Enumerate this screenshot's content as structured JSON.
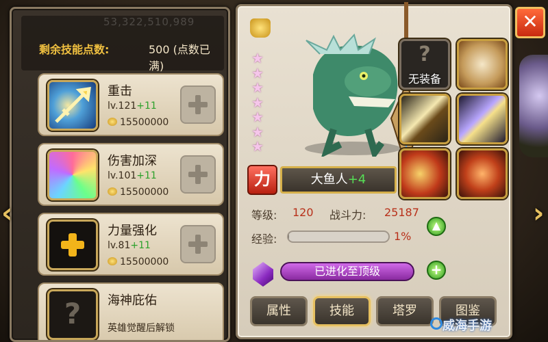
{
  "header": {
    "ghost_text": "53,322,510,989",
    "points_label": "剩余技能点数:",
    "points_value": "500 (点数已满)"
  },
  "skills": [
    {
      "name": "重击",
      "level": "lv.121",
      "level_bonus": "+11",
      "cost": "15500000",
      "icon": "spear-icon"
    },
    {
      "name": "伤害加深",
      "level": "lv.101",
      "level_bonus": "+11",
      "cost": "15500000",
      "icon": "burst-icon"
    },
    {
      "name": "力量强化",
      "level": "lv.81",
      "level_bonus": "+11",
      "cost": "15500000",
      "icon": "cross-icon"
    },
    {
      "name": "海神庇佑",
      "locked_text": "英雄觉醒后解锁",
      "icon": "question-icon"
    }
  ],
  "hero": {
    "star_count": 7,
    "attribute": "力",
    "name": "大鱼人",
    "name_bonus": "+4",
    "level_label": "等级:",
    "level_value": "120",
    "power_label": "战斗力:",
    "power_value": "25187",
    "exp_label": "经验:",
    "exp_pct": "1%",
    "exp_fraction": 0.01,
    "evolve_text": "已进化至顶级"
  },
  "equipment": {
    "empty_label": "无装备",
    "empty_glyph": "?",
    "slots": [
      "empty",
      "armor-icon",
      "sword-icon",
      "dagger-icon",
      "axe-icon",
      "mask-icon"
    ]
  },
  "tabs": [
    {
      "label": "属性",
      "active": false
    },
    {
      "label": "技能",
      "active": true
    },
    {
      "label": "塔罗",
      "active": false
    },
    {
      "label": "图鉴",
      "active": false
    }
  ],
  "glyphs": {
    "close": "✕",
    "star": "★",
    "up": "▲",
    "plus": "+",
    "left_arrow": "‹",
    "right_arrow": "›",
    "question": "?"
  },
  "watermark": "威海手游"
}
